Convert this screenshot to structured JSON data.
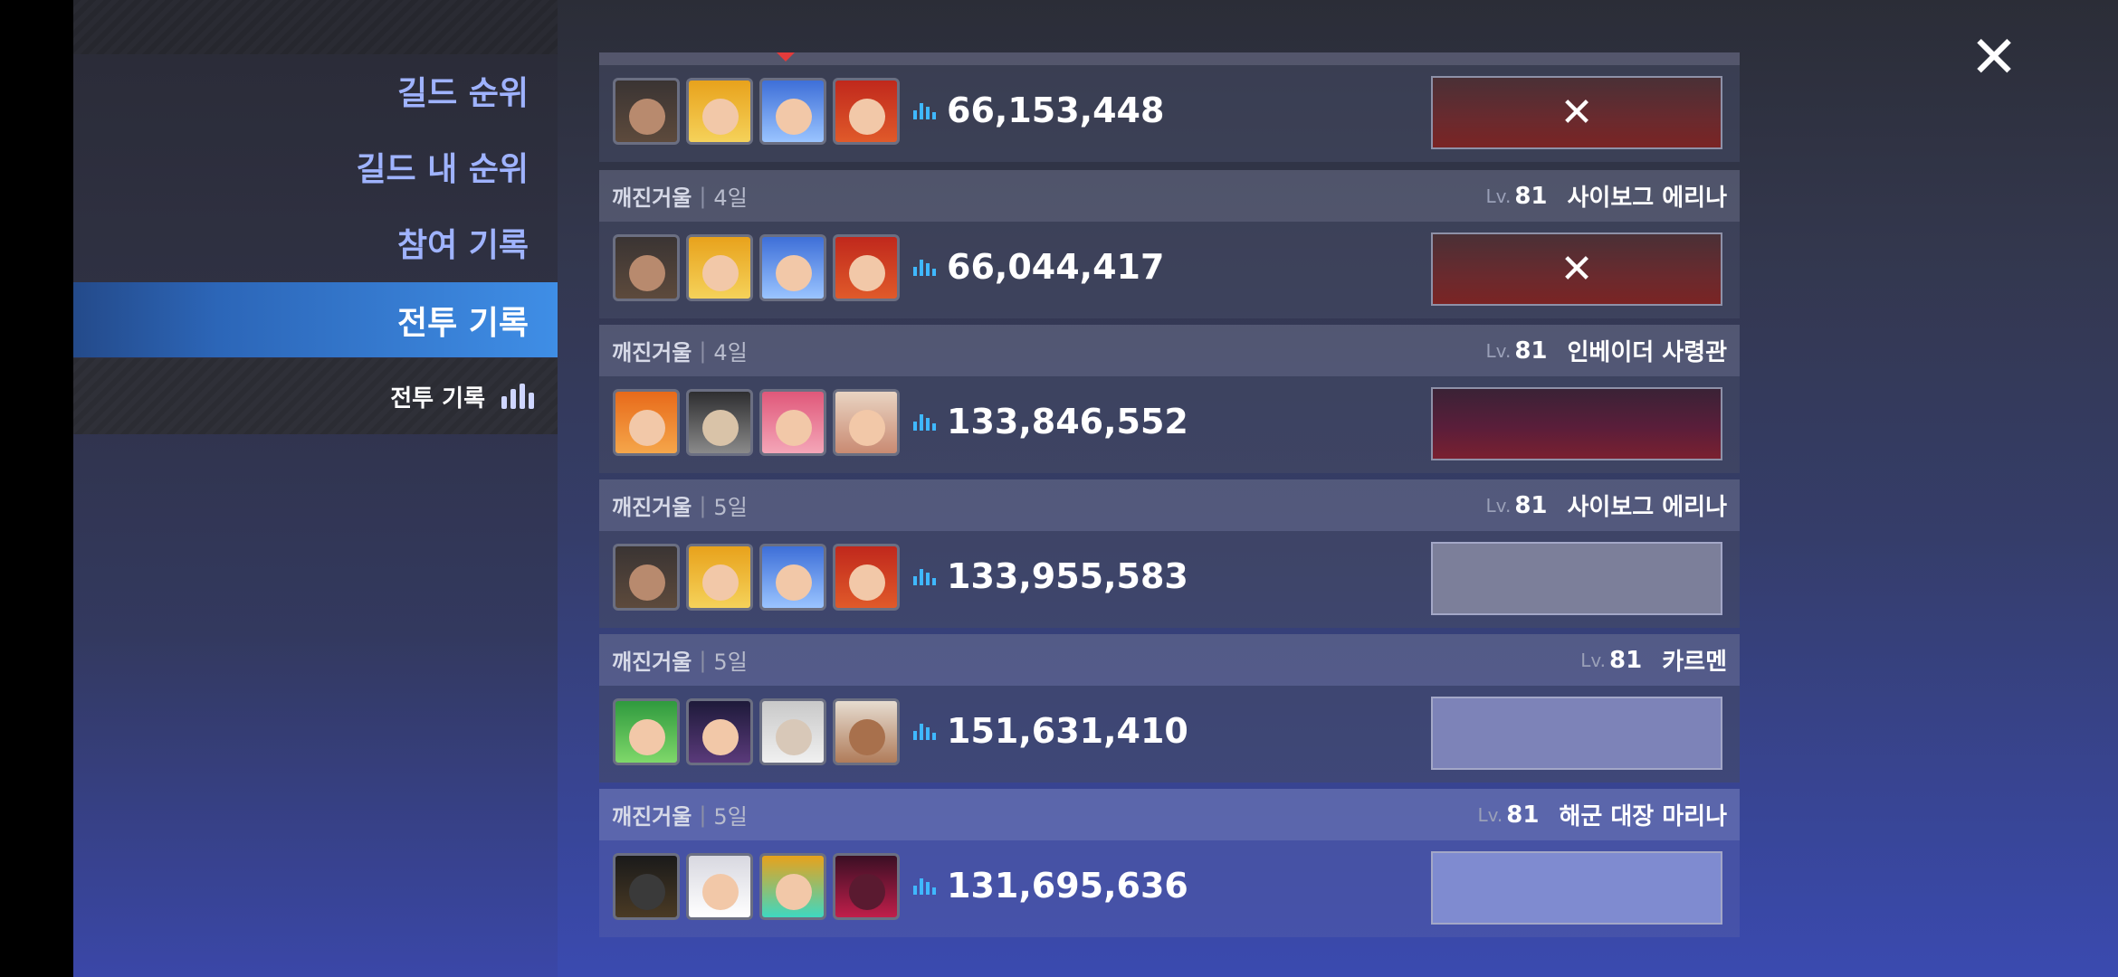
{
  "sidebar": {
    "items": [
      {
        "label": "길드 순위"
      },
      {
        "label": "길드 내 순위"
      },
      {
        "label": "참여 기록"
      },
      {
        "label": "전투 기록"
      }
    ],
    "submenu_label": "전투 기록"
  },
  "close": {
    "label": "✕"
  },
  "entries": [
    {
      "score": "66,153,448",
      "defeated": true
    },
    {
      "mode": "깨진거울",
      "days": "4일",
      "lv_prefix": "Lv.",
      "level": "81",
      "boss": "사이보그 에리나",
      "score": "66,044,417",
      "defeated": true
    },
    {
      "mode": "깨진거울",
      "days": "4일",
      "lv_prefix": "Lv.",
      "level": "81",
      "boss": "인베이더 사령관",
      "score": "133,846,552",
      "defeated": false
    },
    {
      "mode": "깨진거울",
      "days": "5일",
      "lv_prefix": "Lv.",
      "level": "81",
      "boss": "사이보그 에리나",
      "score": "133,955,583",
      "defeated": false
    },
    {
      "mode": "깨진거울",
      "days": "5일",
      "lv_prefix": "Lv.",
      "level": "81",
      "boss": "카르멘",
      "score": "151,631,410",
      "defeated": false
    },
    {
      "mode": "깨진거울",
      "days": "5일",
      "lv_prefix": "Lv.",
      "level": "81",
      "boss": "해군 대장 마리나",
      "score": "131,695,636",
      "defeated": false
    }
  ],
  "icons": {
    "close": "close-icon",
    "stats": "bar-chart-icon",
    "defeated": "x-mark-icon"
  },
  "colors": {
    "active_tab": "#3f8ee6",
    "menu_text": "#9fb3ff",
    "score_icon": "#3fb8ff"
  }
}
